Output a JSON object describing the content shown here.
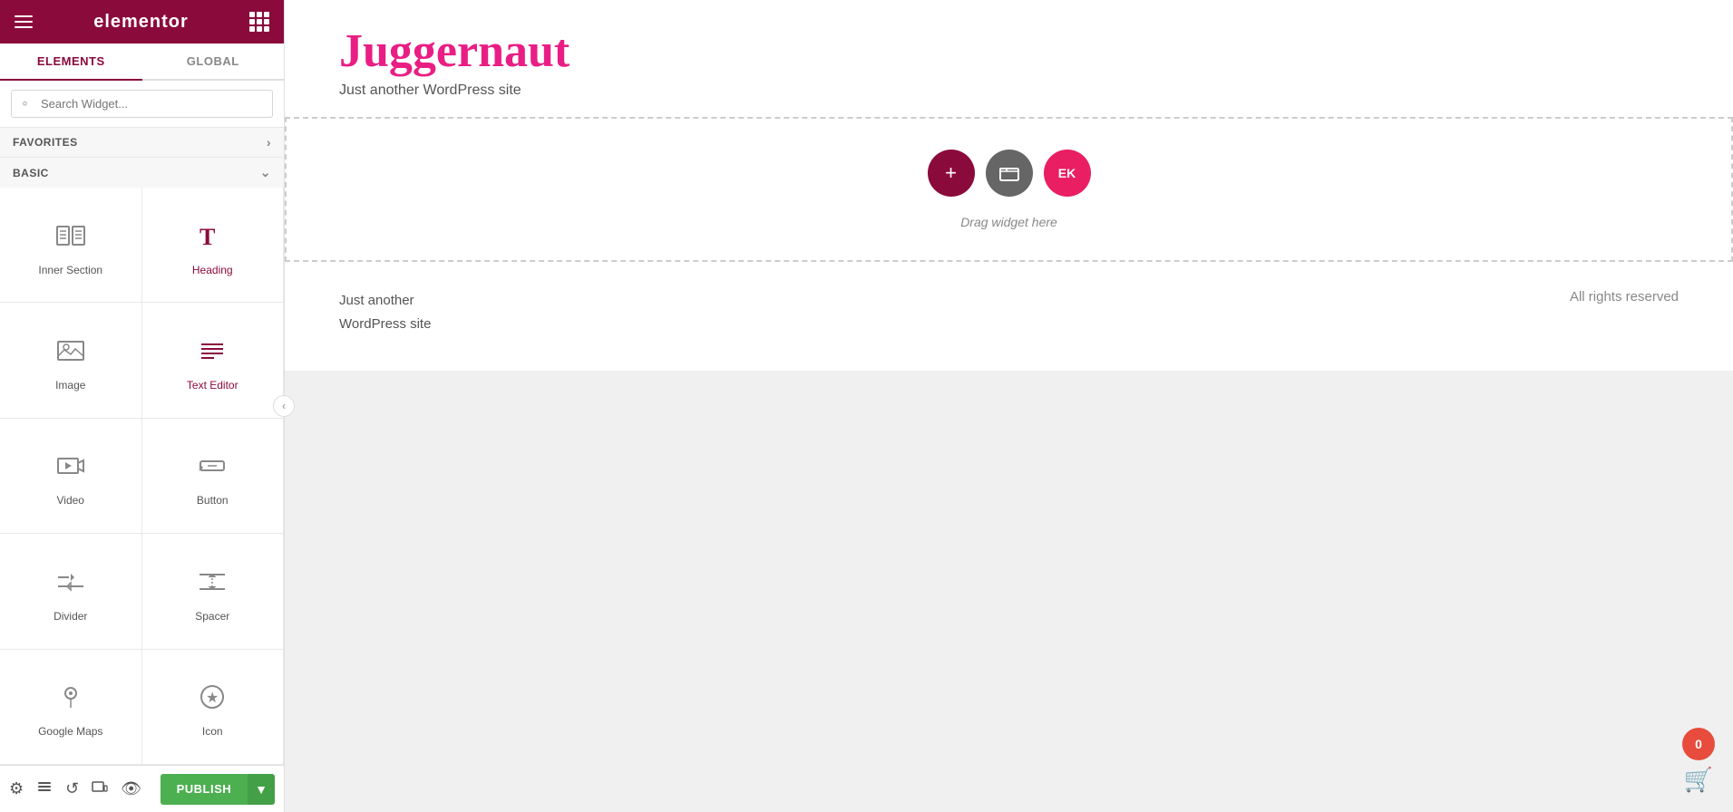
{
  "sidebar": {
    "logo": "elementor",
    "tabs": [
      {
        "id": "elements",
        "label": "ELEMENTS",
        "active": true
      },
      {
        "id": "global",
        "label": "GLOBAL",
        "active": false
      }
    ],
    "search": {
      "placeholder": "Search Widget..."
    },
    "sections": [
      {
        "id": "favorites",
        "label": "FAVORITES",
        "expanded": false,
        "widgets": []
      },
      {
        "id": "basic",
        "label": "BASIC",
        "expanded": true,
        "widgets": [
          {
            "id": "inner-section",
            "label": "Inner Section",
            "icon": "inner-section-icon"
          },
          {
            "id": "heading",
            "label": "Heading",
            "icon": "heading-icon"
          },
          {
            "id": "image",
            "label": "Image",
            "icon": "image-icon"
          },
          {
            "id": "text-editor",
            "label": "Text Editor",
            "icon": "text-editor-icon"
          },
          {
            "id": "video",
            "label": "Video",
            "icon": "video-icon"
          },
          {
            "id": "button",
            "label": "Button",
            "icon": "button-icon"
          },
          {
            "id": "divider",
            "label": "Divider",
            "icon": "divider-icon"
          },
          {
            "id": "spacer",
            "label": "Spacer",
            "icon": "spacer-icon"
          },
          {
            "id": "google-maps",
            "label": "Google Maps",
            "icon": "google-maps-icon"
          },
          {
            "id": "icon",
            "label": "Icon",
            "icon": "icon-widget-icon"
          }
        ]
      }
    ],
    "bottom_icons": [
      "settings-icon",
      "layers-icon",
      "history-icon",
      "responsive-icon",
      "eye-icon"
    ],
    "publish_label": "PUBLISH"
  },
  "canvas": {
    "site_title": "Juggernaut",
    "site_tagline": "Just another WordPress site",
    "drop_hint": "Drag widget here",
    "footer_left_line1": "Just another",
    "footer_left_line2": "WordPress site",
    "footer_right": "All rights reserved",
    "cart_count": "0"
  }
}
